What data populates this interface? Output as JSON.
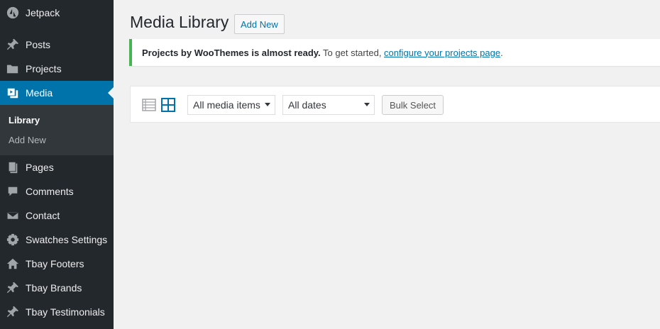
{
  "sidebar": {
    "items": [
      {
        "label": "Jetpack",
        "icon": "jetpack-icon"
      },
      {
        "label": "Posts",
        "icon": "pin-icon"
      },
      {
        "label": "Projects",
        "icon": "folder-icon"
      },
      {
        "label": "Media",
        "icon": "media-icon"
      },
      {
        "label": "Pages",
        "icon": "pages-icon"
      },
      {
        "label": "Comments",
        "icon": "comment-icon"
      },
      {
        "label": "Contact",
        "icon": "envelope-icon"
      },
      {
        "label": "Swatches Settings",
        "icon": "gear-icon"
      },
      {
        "label": "Tbay Footers",
        "icon": "home-icon"
      },
      {
        "label": "Tbay Brands",
        "icon": "pin-icon"
      },
      {
        "label": "Tbay Testimonials",
        "icon": "pin-icon"
      }
    ],
    "submenu": [
      {
        "label": "Library"
      },
      {
        "label": "Add New"
      }
    ],
    "current": "Media"
  },
  "main": {
    "title": "Media Library",
    "add_new_label": "Add New"
  },
  "notice": {
    "bold_text": "Projects by WooThemes is almost ready.",
    "text": " To get started, ",
    "link_text": "configure your projects page",
    "end": "."
  },
  "toolbar": {
    "filter_type": "All media items",
    "filter_date": "All dates",
    "bulk_select_label": "Bulk Select"
  },
  "colors": {
    "sidebar_bg": "#23282d",
    "accent": "#0073aa",
    "notice_border": "#46b450"
  }
}
